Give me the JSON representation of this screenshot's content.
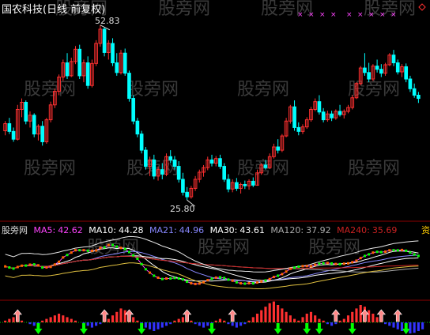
{
  "header": {
    "title": "国农科技(日线 前复权)",
    "title_color": "#ffffff"
  },
  "watermark": {
    "text": "股旁网",
    "color": "#3a3a3a"
  },
  "price_panel": {
    "high_label": "52.83",
    "low_label": "25.80",
    "up_color": "#ff3030",
    "down_color": "#00ffff",
    "marker_color": "#ff44ff"
  },
  "indicator_bar": {
    "name": "股旁网",
    "items": [
      {
        "label": "MA5:",
        "value": "42.62",
        "color": "#ff44ff"
      },
      {
        "label": "MA10:",
        "value": "44.28",
        "color": "#ffffff"
      },
      {
        "label": "MA21:",
        "value": "44.96",
        "color": "#8888ff"
      },
      {
        "label": "MA30:",
        "value": "43.61",
        "color": "#ffffff"
      },
      {
        "label": "MA120:",
        "value": "37.92",
        "color": "#aaaaaa"
      },
      {
        "label": "MA240:",
        "value": "35.69",
        "color": "#cc2222"
      }
    ],
    "tail_char": "资",
    "tail_color": "#ffcc00"
  },
  "chart_data": [
    {
      "type": "candlestick",
      "title": "",
      "annotations": [
        {
          "label": "52.83",
          "kind": "high"
        },
        {
          "label": "25.80",
          "kind": "low"
        }
      ],
      "ylim": [
        23.5,
        55.0
      ],
      "candles": [
        [
          36.5,
          38.0,
          35.8,
          37.6
        ],
        [
          37.6,
          38.5,
          36.0,
          36.4
        ],
        [
          36.4,
          37.0,
          34.8,
          35.2
        ],
        [
          35.2,
          40.5,
          35.0,
          39.8
        ],
        [
          39.8,
          41.5,
          38.6,
          40.9
        ],
        [
          40.9,
          41.2,
          37.5,
          38.0
        ],
        [
          38.0,
          39.5,
          37.0,
          38.9
        ],
        [
          38.9,
          39.2,
          35.5,
          36.0
        ],
        [
          36.0,
          37.5,
          35.0,
          37.2
        ],
        [
          37.2,
          38.0,
          34.2,
          34.8
        ],
        [
          34.8,
          38.5,
          34.5,
          38.2
        ],
        [
          38.2,
          41.0,
          37.8,
          40.5
        ],
        [
          40.5,
          43.0,
          40.0,
          42.6
        ],
        [
          42.6,
          45.2,
          42.0,
          44.8
        ],
        [
          44.8,
          47.5,
          44.2,
          47.0
        ],
        [
          47.0,
          48.5,
          44.5,
          45.0
        ],
        [
          45.0,
          47.8,
          44.8,
          47.2
        ],
        [
          47.2,
          49.6,
          46.8,
          49.1
        ],
        [
          49.1,
          49.8,
          44.5,
          45.0
        ],
        [
          45.0,
          47.5,
          44.0,
          47.0
        ],
        [
          47.0,
          48.0,
          43.0,
          43.5
        ],
        [
          43.5,
          47.5,
          43.2,
          46.9
        ],
        [
          46.9,
          50.5,
          46.5,
          50.0
        ],
        [
          50.0,
          52.83,
          49.5,
          52.2
        ],
        [
          52.2,
          52.5,
          48.0,
          48.6
        ],
        [
          48.6,
          50.5,
          47.5,
          50.0
        ],
        [
          50.0,
          50.8,
          46.5,
          47.0
        ],
        [
          47.0,
          48.5,
          45.0,
          45.5
        ],
        [
          45.5,
          49.0,
          45.2,
          48.5
        ],
        [
          48.5,
          49.2,
          45.0,
          45.4
        ],
        [
          45.4,
          45.8,
          41.0,
          41.5
        ],
        [
          41.5,
          42.0,
          37.5,
          38.0
        ],
        [
          38.0,
          38.5,
          35.5,
          36.0
        ],
        [
          36.0,
          36.5,
          33.0,
          33.5
        ],
        [
          33.5,
          34.0,
          30.5,
          31.0
        ],
        [
          31.0,
          32.5,
          29.5,
          32.0
        ],
        [
          32.0,
          32.8,
          29.0,
          29.5
        ],
        [
          29.5,
          31.0,
          28.8,
          30.5
        ],
        [
          30.5,
          31.5,
          29.0,
          29.8
        ],
        [
          29.8,
          33.0,
          29.5,
          32.5
        ],
        [
          32.5,
          33.5,
          31.5,
          32.0
        ],
        [
          32.0,
          32.6,
          30.5,
          31.0
        ],
        [
          31.0,
          31.8,
          28.5,
          29.0
        ],
        [
          29.0,
          30.0,
          26.5,
          27.0
        ],
        [
          27.0,
          27.8,
          25.8,
          26.3
        ],
        [
          26.3,
          28.0,
          26.0,
          27.6
        ],
        [
          27.6,
          29.5,
          27.2,
          29.0
        ],
        [
          29.0,
          30.5,
          28.5,
          30.1
        ],
        [
          30.1,
          31.2,
          29.4,
          30.8
        ],
        [
          30.8,
          32.5,
          30.4,
          32.0
        ],
        [
          32.0,
          32.8,
          31.0,
          31.5
        ],
        [
          31.5,
          32.6,
          31.0,
          32.2
        ],
        [
          32.2,
          32.8,
          30.6,
          31.0
        ],
        [
          31.0,
          31.5,
          28.6,
          29.0
        ],
        [
          29.0,
          29.8,
          27.0,
          27.5
        ],
        [
          27.5,
          29.0,
          27.0,
          28.5
        ],
        [
          28.5,
          29.2,
          27.2,
          27.6
        ],
        [
          27.6,
          28.5,
          26.8,
          28.2
        ],
        [
          28.2,
          28.8,
          27.5,
          28.0
        ],
        [
          28.0,
          29.0,
          27.4,
          28.7
        ],
        [
          28.7,
          29.3,
          27.8,
          28.1
        ],
        [
          28.1,
          30.5,
          28.0,
          30.0
        ],
        [
          30.0,
          31.5,
          29.7,
          31.2
        ],
        [
          31.2,
          32.0,
          30.5,
          30.8
        ],
        [
          30.8,
          33.0,
          30.6,
          32.5
        ],
        [
          32.5,
          34.5,
          32.2,
          34.0
        ],
        [
          34.0,
          35.2,
          33.0,
          33.5
        ],
        [
          33.5,
          36.0,
          33.2,
          35.7
        ],
        [
          35.7,
          38.5,
          35.5,
          38.0
        ],
        [
          38.0,
          40.5,
          37.6,
          40.2
        ],
        [
          40.2,
          41.2,
          36.5,
          37.0
        ],
        [
          37.0,
          37.8,
          35.8,
          36.4
        ],
        [
          36.4,
          37.5,
          36.0,
          37.1
        ],
        [
          37.1,
          38.6,
          36.8,
          38.2
        ],
        [
          38.2,
          40.2,
          37.9,
          39.8
        ],
        [
          39.8,
          41.5,
          39.5,
          41.0
        ],
        [
          41.0,
          42.0,
          39.0,
          39.4
        ],
        [
          39.4,
          40.0,
          37.8,
          38.2
        ],
        [
          38.2,
          39.6,
          37.9,
          39.1
        ],
        [
          39.1,
          39.6,
          38.0,
          38.5
        ],
        [
          38.5,
          39.8,
          38.2,
          39.5
        ],
        [
          39.5,
          40.5,
          38.7,
          39.0
        ],
        [
          39.0,
          39.8,
          38.4,
          39.5
        ],
        [
          39.5,
          40.5,
          39.2,
          40.1
        ],
        [
          40.1,
          42.0,
          39.8,
          41.6
        ],
        [
          41.6,
          44.0,
          41.4,
          43.8
        ],
        [
          43.8,
          46.5,
          43.5,
          46.2
        ],
        [
          46.2,
          48.5,
          45.0,
          45.5
        ],
        [
          45.5,
          47.0,
          44.0,
          44.5
        ],
        [
          44.5,
          46.8,
          44.2,
          46.5
        ],
        [
          46.5,
          47.5,
          45.5,
          46.0
        ],
        [
          46.0,
          46.8,
          44.8,
          45.4
        ],
        [
          45.4,
          47.0,
          45.0,
          46.7
        ],
        [
          46.7,
          48.5,
          46.5,
          48.2
        ],
        [
          48.2,
          49.0,
          46.5,
          47.0
        ],
        [
          47.0,
          47.5,
          45.2,
          45.6
        ],
        [
          45.6,
          46.8,
          44.8,
          46.4
        ],
        [
          46.4,
          46.9,
          44.0,
          44.5
        ],
        [
          44.5,
          45.0,
          42.5,
          43.0
        ],
        [
          43.0,
          43.8,
          41.6,
          42.0
        ],
        [
          42.0,
          42.5,
          40.8,
          41.5
        ]
      ],
      "top_markers_count": 9,
      "bottom_markers_count": 0
    },
    {
      "type": "line",
      "title": "",
      "series": [
        {
          "name": "MA5",
          "color": "#ff44ff",
          "values": []
        },
        {
          "name": "MA10",
          "color": "#ffffff",
          "values": []
        },
        {
          "name": "MA21",
          "color": "#8888ff",
          "values": []
        },
        {
          "name": "MA30",
          "color": "#ffffff",
          "values": []
        },
        {
          "name": "MA120",
          "color": "#aaaaaa",
          "values": []
        },
        {
          "name": "MA240",
          "color": "#cc2222",
          "values": []
        }
      ],
      "last_values": {
        "MA5": 42.62,
        "MA10": 44.28,
        "MA21": 44.96,
        "MA30": 43.61,
        "MA120": 37.92,
        "MA240": 35.69
      }
    },
    {
      "type": "bar",
      "title": "",
      "note": "signal histogram with up/down arrows",
      "values": [
        1,
        2,
        3,
        2,
        1,
        0,
        -1,
        -2,
        -1,
        1,
        2,
        3,
        4,
        5,
        4,
        3,
        2,
        1,
        0,
        -1,
        -2,
        -3,
        -2,
        -1,
        1,
        2,
        4,
        6,
        8,
        7,
        5,
        3,
        1,
        -1,
        -3,
        -4,
        -5,
        -4,
        -3,
        -2,
        -1,
        1,
        2,
        3,
        2,
        1,
        -1,
        -2,
        -3,
        -2,
        -1,
        1,
        2,
        1,
        -1,
        -2,
        -3,
        -2,
        -1,
        1,
        3,
        5,
        7,
        9,
        11,
        12,
        10,
        8,
        6,
        4,
        2,
        1,
        3,
        5,
        6,
        4,
        2,
        1,
        -1,
        -2,
        -1,
        1,
        2,
        4,
        6,
        8,
        10,
        9,
        7,
        5,
        3,
        1,
        -1,
        -2,
        -3,
        -4,
        -5,
        -6,
        -7,
        -6,
        -5,
        -4
      ],
      "up_arrow_positions": [
        3,
        24,
        30,
        44,
        55,
        80,
        87,
        91,
        95
      ],
      "down_arrow_positions": [
        8,
        19,
        33,
        50,
        66,
        73,
        76,
        84,
        97
      ]
    }
  ]
}
